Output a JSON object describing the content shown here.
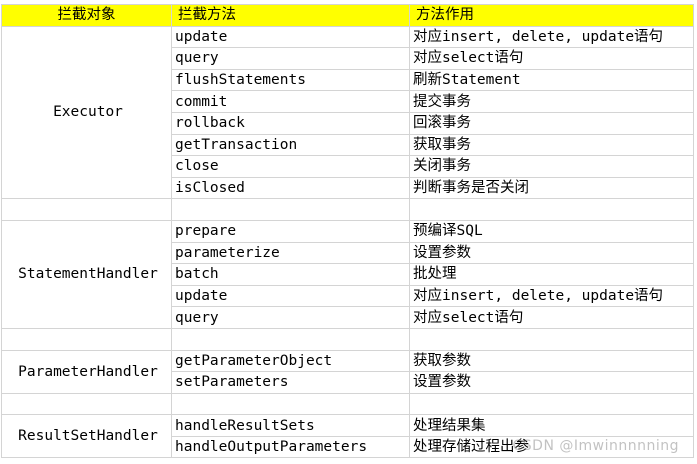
{
  "headers": {
    "object": "拦截对象",
    "method": "拦截方法",
    "purpose": "方法作用"
  },
  "groups": [
    {
      "object": "Executor",
      "rows": [
        {
          "method": "update",
          "purpose": "对应insert, delete, update语句"
        },
        {
          "method": "query",
          "purpose": "对应select语句"
        },
        {
          "method": "flushStatements",
          "purpose": "刷新Statement"
        },
        {
          "method": "commit",
          "purpose": "提交事务"
        },
        {
          "method": "rollback",
          "purpose": "回滚事务"
        },
        {
          "method": "getTransaction",
          "purpose": "获取事务"
        },
        {
          "method": "close",
          "purpose": "关闭事务"
        },
        {
          "method": "isClosed",
          "purpose": "判断事务是否关闭"
        }
      ]
    },
    {
      "object": "StatementHandler",
      "rows": [
        {
          "method": "prepare",
          "purpose": "预编译SQL"
        },
        {
          "method": "parameterize",
          "purpose": "设置参数"
        },
        {
          "method": "batch",
          "purpose": "批处理"
        },
        {
          "method": "update",
          "purpose": "对应insert, delete, update语句"
        },
        {
          "method": "query",
          "purpose": "对应select语句"
        }
      ]
    },
    {
      "object": "ParameterHandler",
      "rows": [
        {
          "method": "getParameterObject",
          "purpose": "获取参数"
        },
        {
          "method": "setParameters",
          "purpose": "设置参数"
        }
      ]
    },
    {
      "object": "ResultSetHandler",
      "rows": [
        {
          "method": "handleResultSets",
          "purpose": "处理结果集"
        },
        {
          "method": "handleOutputParameters",
          "purpose": "处理存储过程出参"
        }
      ]
    }
  ],
  "watermark": "CSDN @Imwinnnnning",
  "colors": {
    "header_bg": "#ffff00",
    "grid_line": "#d4d4d4"
  }
}
